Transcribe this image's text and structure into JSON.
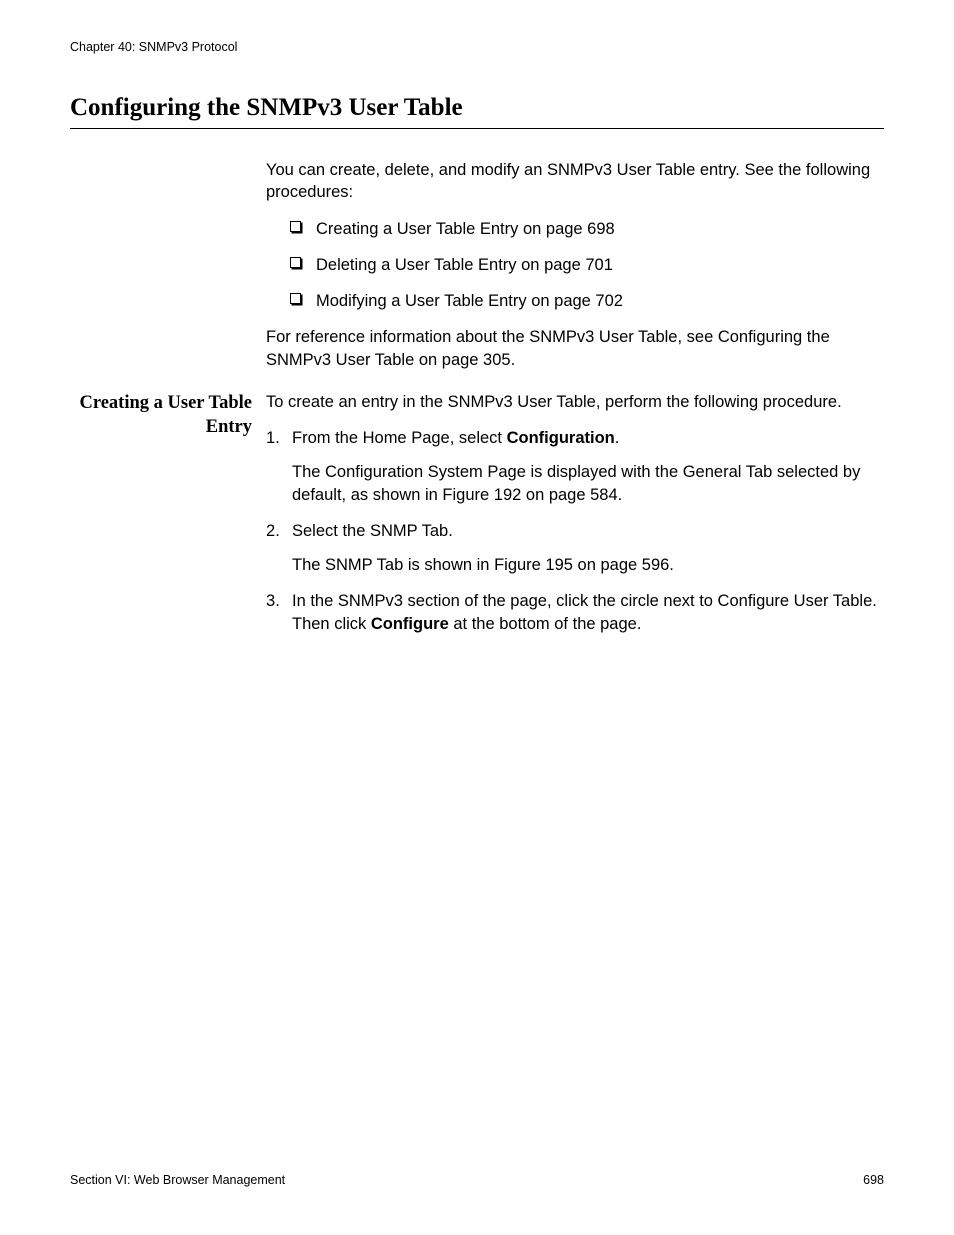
{
  "header": {
    "chapter": "Chapter 40: SNMPv3 Protocol"
  },
  "title": "Configuring the SNMPv3 User Table",
  "intro": "You can create, delete, and modify an SNMPv3 User Table entry. See the following procedures:",
  "bullets": [
    "Creating a User Table Entry on page 698",
    "Deleting a User Table Entry on page 701",
    "Modifying a User Table Entry on page 702"
  ],
  "ref": "For reference information about the SNMPv3 User Table, see Configuring the SNMPv3 User Table on page 305.",
  "subhead": "Creating a User Table Entry",
  "subintro": "To create an entry in the SNMPv3 User Table, perform the following procedure.",
  "steps": {
    "s1_a": "From the Home Page, select ",
    "s1_b": "Configuration",
    "s1_c": ".",
    "s1_p": "The Configuration System Page is displayed with the General Tab selected by default, as shown in Figure 192 on page 584.",
    "s2": "Select the SNMP Tab.",
    "s2_p": "The SNMP Tab is shown in Figure 195 on page 596.",
    "s3_a": "In the SNMPv3 section of the page, click the circle next to Configure User Table. Then click ",
    "s3_b": "Configure",
    "s3_c": " at the bottom of the page."
  },
  "footer": {
    "section": "Section VI: Web Browser Management",
    "page": "698"
  }
}
